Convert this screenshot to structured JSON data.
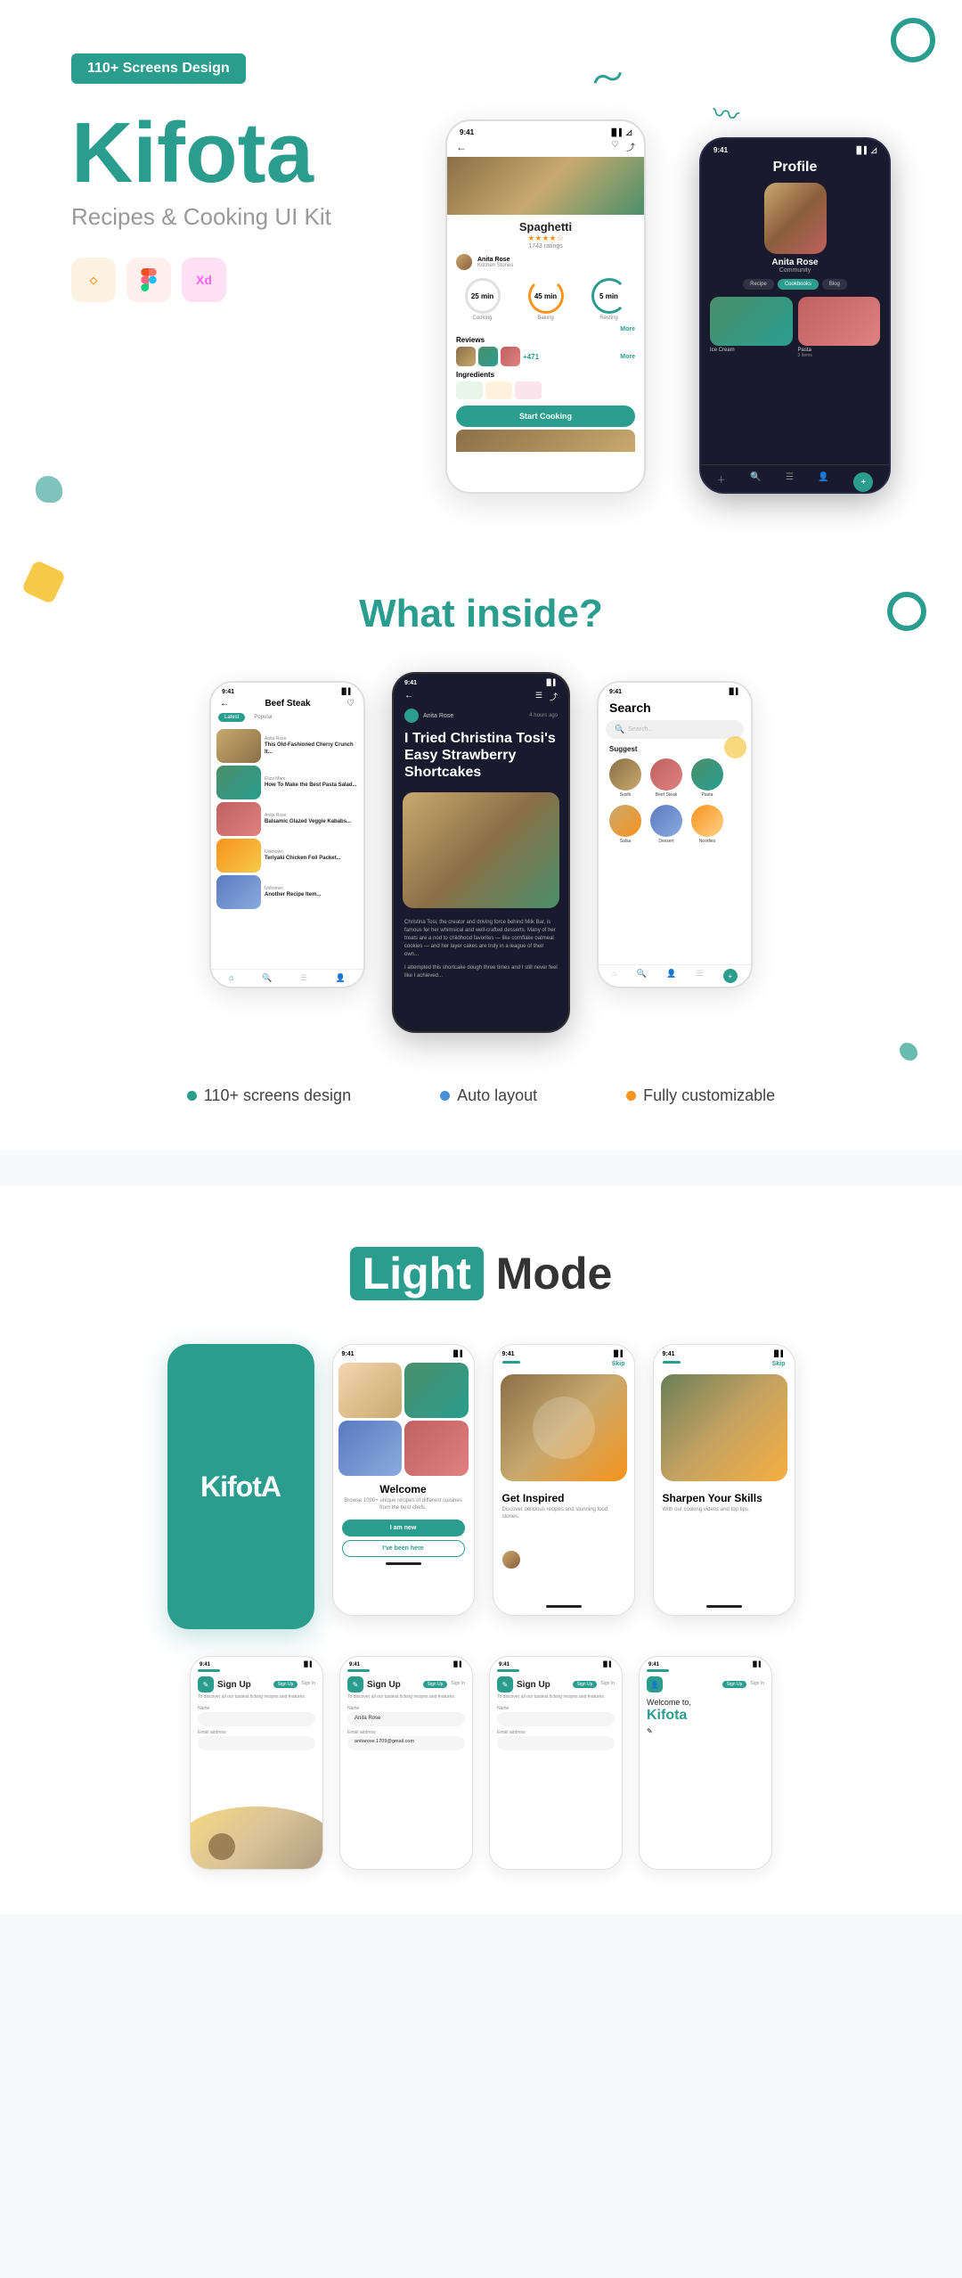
{
  "hero": {
    "badge": "110+ Screens Design",
    "title": "Kifota",
    "subtitle": "Recipes & Cooking UI Kit",
    "tools": [
      "Sketch",
      "Figma",
      "Xd"
    ],
    "recipe_screen": {
      "time": "9:41",
      "dish": "Spaghetti",
      "ratings": "1743 ratings",
      "author": "Anita Rose",
      "author_sub": "Kitchen Stories",
      "cook_time": "25 min",
      "bake_time": "45 min",
      "rest_time": "5 min",
      "cook_label": "Cooking",
      "bake_label": "Baking",
      "rest_label": "Resting",
      "more": "More",
      "reviews": "Reviews",
      "plus_count": "+471",
      "ingredients": "Ingredients",
      "start_btn": "Start Cooking"
    },
    "profile_screen": {
      "time": "9:41",
      "title": "Profile",
      "name": "Anita Rose",
      "community": "Community",
      "tabs": [
        "Recipe",
        "Cookbooks",
        "Blog"
      ],
      "items": [
        "Ice Cream",
        "Pasta"
      ],
      "item_counts": [
        "",
        "3 Items"
      ]
    }
  },
  "what_inside": {
    "title": "What inside?",
    "phones": [
      {
        "type": "feed",
        "time": "9:41",
        "title": "Beef Steak",
        "items": [
          "This Old-Fashioned Cherry Crunch It...",
          "How To Make the Best Pasta Salad...",
          "Balsamic Glazed Veggie Kababs...",
          "Teriyaki Chicken Foil Packet..."
        ]
      },
      {
        "type": "article",
        "time": "9:41",
        "title": "I Tried Christina Tosi's Easy Strawberry Shortcakes",
        "author": "Anita Rose",
        "time_ago": "4 hours ago",
        "dark": true
      },
      {
        "type": "search",
        "time": "9:41",
        "title": "Search",
        "placeholder": "Search...",
        "suggest_label": "Suggest",
        "items": [
          "Sushi",
          "Beef Steak",
          "Pasta",
          "Salsa",
          "Dessert",
          "Noodles"
        ]
      }
    ],
    "features": [
      {
        "label": "110+ screens design",
        "color": "teal"
      },
      {
        "label": "Auto layout",
        "color": "blue"
      },
      {
        "label": "Fully customizable",
        "color": "orange"
      }
    ]
  },
  "light_mode": {
    "title_highlight": "Light",
    "title_rest": "Mode",
    "screens": [
      {
        "type": "splash",
        "logo": "KifotA"
      },
      {
        "type": "welcome",
        "title": "Welcome",
        "desc": "Browse 1000+ unique recipes of different cuisines from the best chefs.",
        "btn1": "I am new",
        "btn2": "I've been here"
      },
      {
        "type": "onboard1",
        "skip": "Skip",
        "title": "Get Inspired",
        "desc": "Discover delicious recipes and stunning food stories."
      },
      {
        "type": "onboard2",
        "skip": "Skip",
        "title": "Sharpen Your Skills",
        "desc": "With our cooking videos and top tips."
      }
    ]
  },
  "signup_row": {
    "screens": [
      {
        "type": "signup",
        "tab_active": "Sign Up",
        "tab_inactive": "Sign In",
        "title": "Sign Up",
        "desc": "To discover all our tastiest ticking recipes and features.",
        "label1": "Name",
        "label2": "Email address",
        "field1": "",
        "field2": ""
      },
      {
        "type": "signup",
        "tab_active": "Sign Up",
        "tab_inactive": "Sign In",
        "title": "Sign Up",
        "desc": "To discover all our tastiest ticking recipes and features.",
        "label1": "Name",
        "label2": "Email address",
        "field1": "Anita Rose",
        "field2": "anitarose.1709@gmail.com"
      },
      {
        "type": "signup2",
        "tab_active": "Sign Up",
        "tab_inactive": "Sign In",
        "title": "Sign Up",
        "desc": "To discover all our tastiest ticking recipes and features.",
        "label1": "Name",
        "label2": "Email address",
        "field1": "",
        "field2": ""
      },
      {
        "type": "welcome2",
        "tab_active": "Sign Up",
        "tab_inactive": "Sign In",
        "title": "Welcome to,",
        "brand": "Kifota"
      }
    ]
  }
}
